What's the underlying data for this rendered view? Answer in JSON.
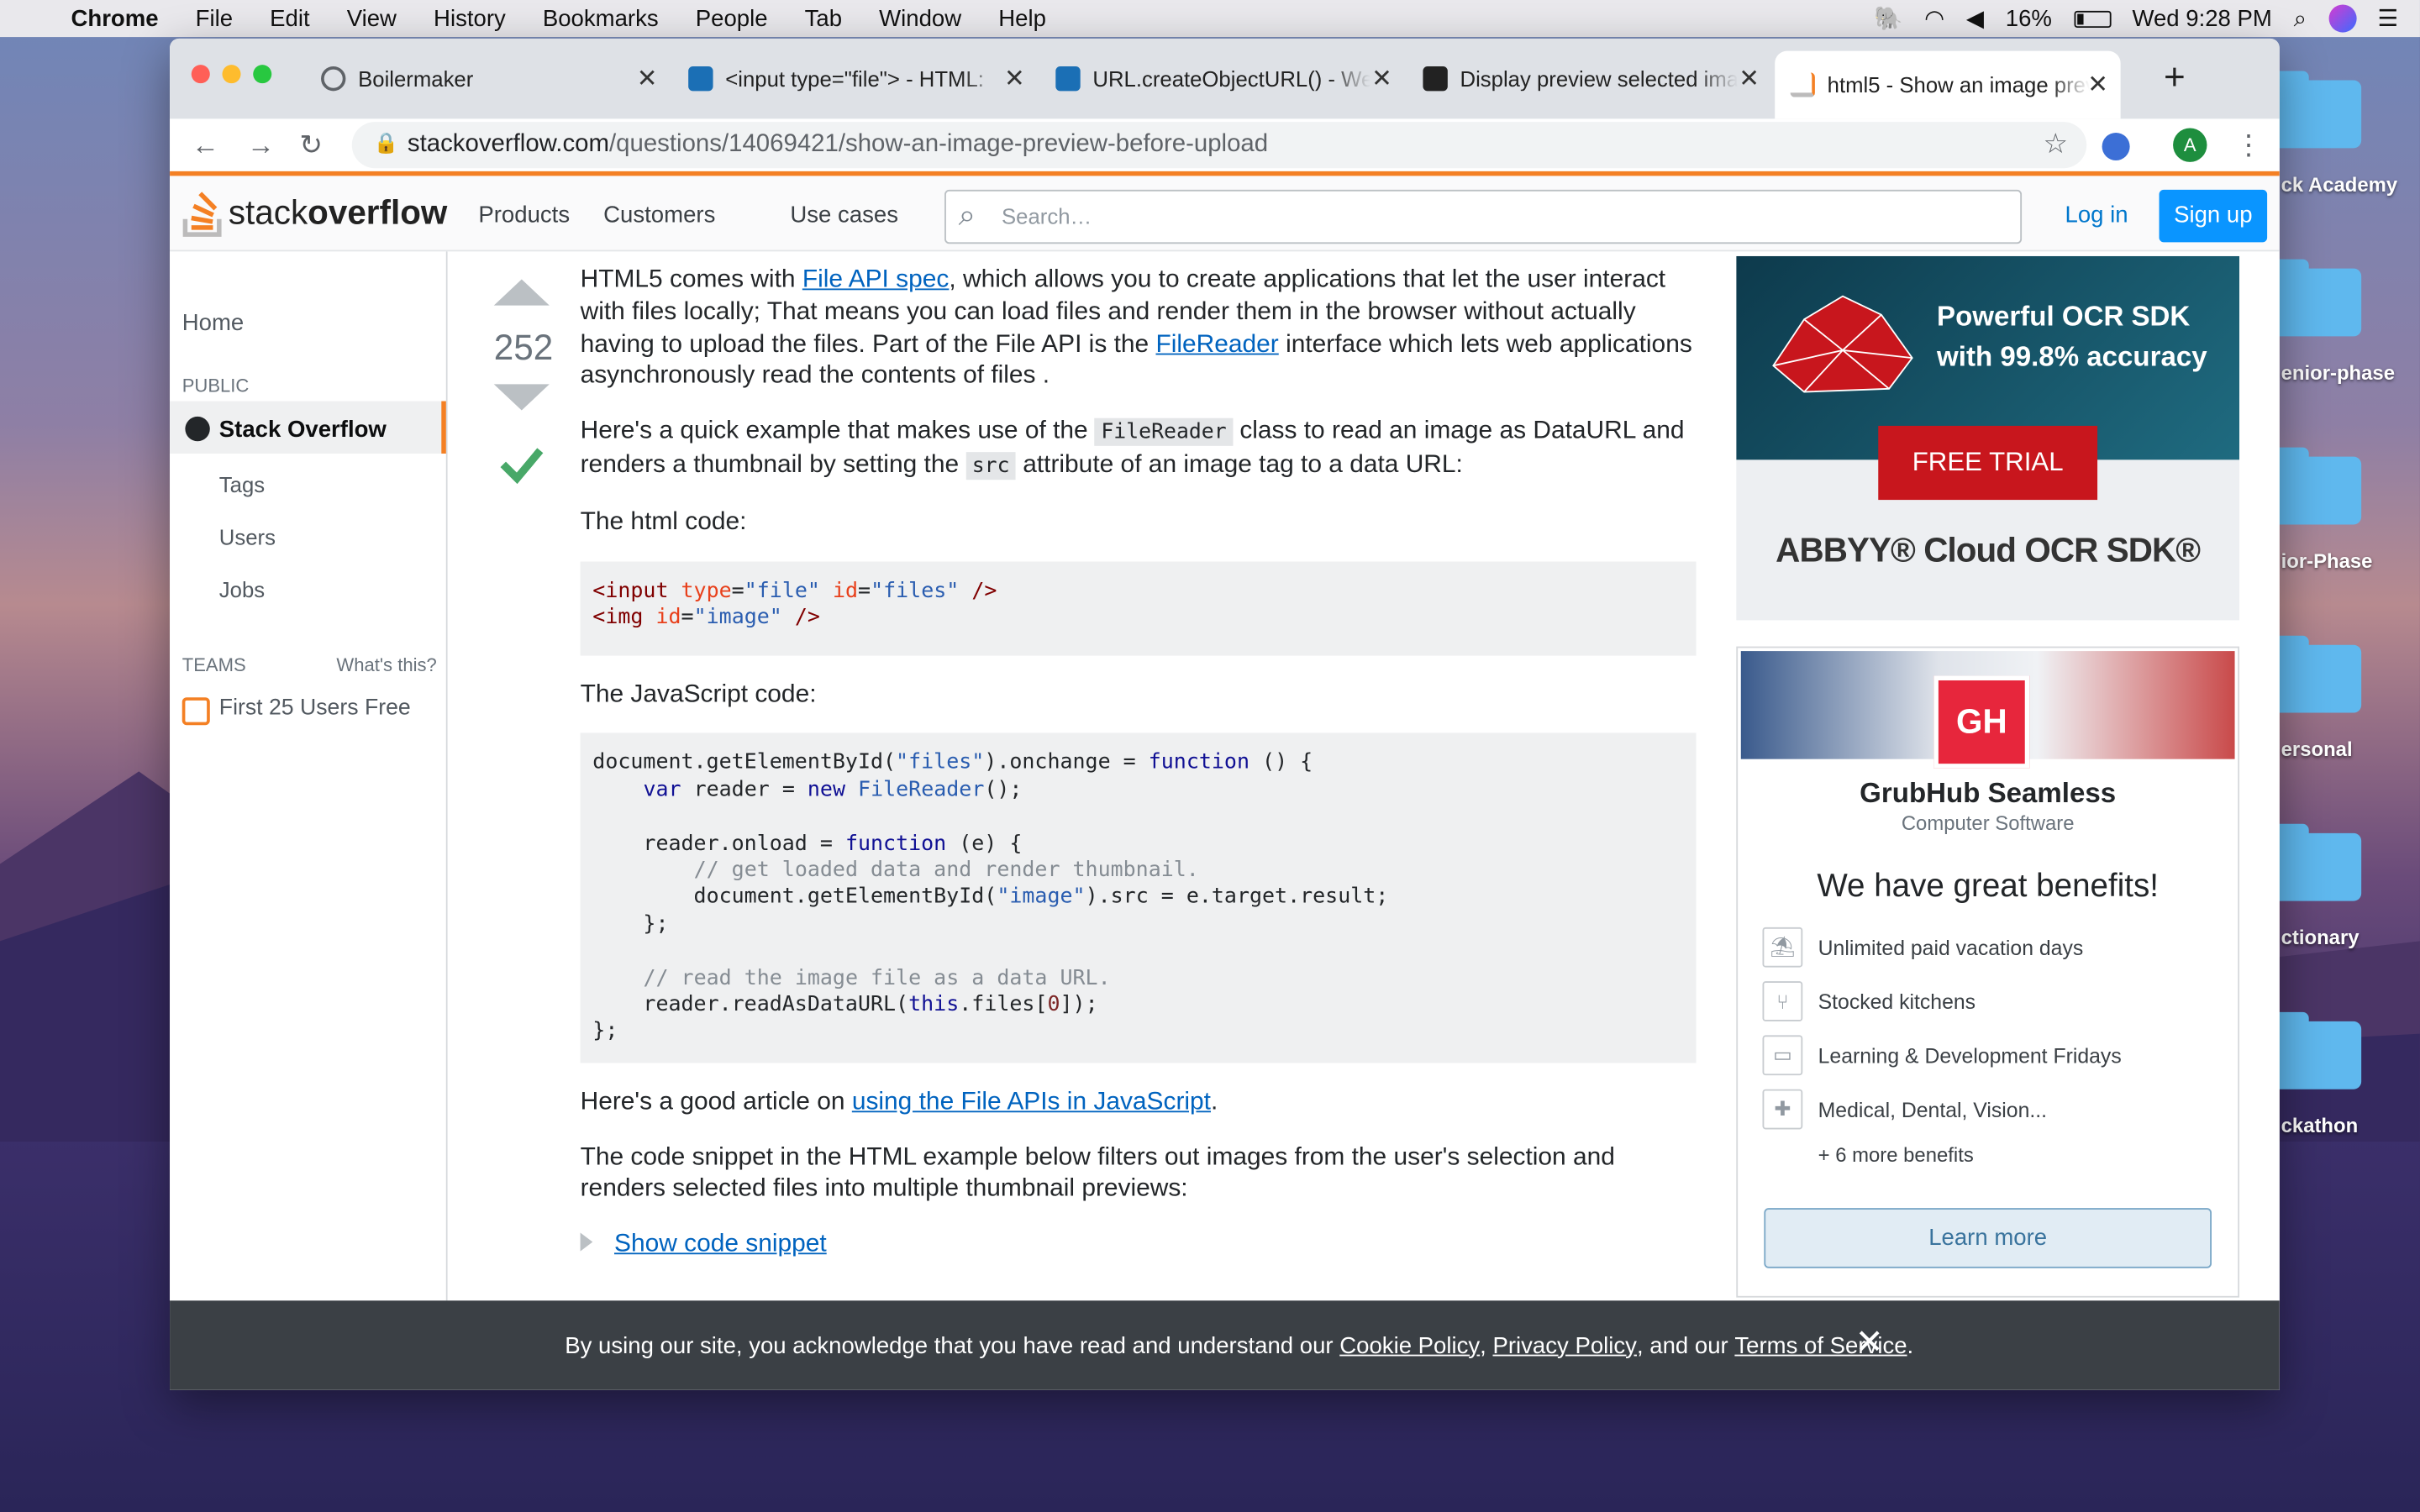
{
  "menubar": {
    "app": "Chrome",
    "items": [
      "File",
      "Edit",
      "View",
      "History",
      "Bookmarks",
      "People",
      "Tab",
      "Window",
      "Help"
    ],
    "battery": "16%",
    "clock": "Wed 9:28 PM"
  },
  "desktop": {
    "labels": [
      "ck Academy",
      "enior-phase",
      "ior-Phase",
      "ersonal",
      "ctionary",
      "ckathon"
    ]
  },
  "tabs": [
    {
      "title": "Boilermaker"
    },
    {
      "title": "<input type=\"file\"> - HTML:"
    },
    {
      "title": "URL.createObjectURL() - We"
    },
    {
      "title": "Display preview selected ima"
    },
    {
      "title": "html5 - Show an image previ"
    }
  ],
  "address": {
    "host": "stackoverflow.com",
    "path": "/questions/14069421/show-an-image-preview-before-upload"
  },
  "so_header": {
    "logo_a": "stack",
    "logo_b": "overflow",
    "nav": [
      "Products",
      "Customers",
      "Use cases"
    ],
    "search_placeholder": "Search…",
    "login": "Log in",
    "signup": "Sign up"
  },
  "left_sidebar": {
    "home": "Home",
    "public": "PUBLIC",
    "stack_overflow": "Stack Overflow",
    "tags": "Tags",
    "users": "Users",
    "jobs": "Jobs",
    "teams": "TEAMS",
    "whats_this": "What's this?",
    "free": "First 25 Users Free"
  },
  "answer": {
    "score": "252",
    "p1_a": "HTML5 comes with ",
    "p1_link1": "File API spec",
    "p1_b": ", which allows you to create applications that let the user interact with files locally; That means you can load files and render them in the browser without actually having to upload the files. Part of the File API is the ",
    "p1_link2": "FileReader",
    "p1_c": " interface which lets web applications asynchronously read the contents of files .",
    "p2_a": "Here's a quick example that makes use of the ",
    "p2_code1": "FileReader",
    "p2_b": " class to read an image as DataURL and renders a thumbnail by setting the ",
    "p2_code2": "src",
    "p2_c": " attribute of an image tag to a data URL:",
    "html_label": "The html code:",
    "js_label": "The JavaScript code:",
    "p3_a": "Here's a good article on ",
    "p3_link": "using the File APIs in JavaScript",
    "p3_b": ".",
    "p4": "The code snippet in the HTML example below filters out images from the user's selection and renders selected files into multiple thumbnail previews:",
    "snippet": "Show code snippet"
  },
  "ad": {
    "headline": "Powerful OCR SDK with 99.8% accuracy",
    "cta": "FREE TRIAL",
    "brand": "ABBYY® Cloud OCR SDK®"
  },
  "job": {
    "logo": "GH",
    "company": "GrubHub Seamless",
    "category": "Computer Software",
    "heading": "We have great benefits!",
    "benefits": [
      "Unlimited paid vacation days",
      "Stocked kitchens",
      "Learning & Development Fridays",
      "Medical, Dental, Vision..."
    ],
    "more": "+ 6 more benefits",
    "cta": "Learn more"
  },
  "cookie": {
    "text": "By using our site, you acknowledge that you have read and understand our ",
    "link1": "Cookie Policy",
    "sep1": ", ",
    "link2": "Privacy Policy",
    "sep2": ", and our ",
    "link3": "Terms of Service",
    "end": "."
  }
}
